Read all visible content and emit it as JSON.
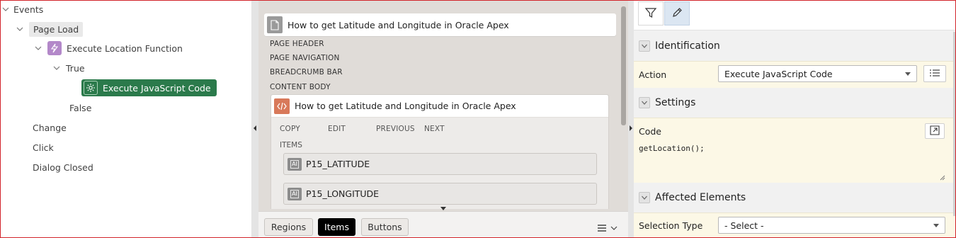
{
  "tree": {
    "events_label": "Events",
    "page_load_label": "Page Load",
    "execute_location_label": "Execute Location Function",
    "true_label": "True",
    "execute_js_label": "Execute JavaScript Code",
    "false_label": "False",
    "change_label": "Change",
    "click_label": "Click",
    "dialog_closed_label": "Dialog Closed"
  },
  "layout_panel": {
    "page_title": "How to get Latitude and Longitude in Oracle Apex",
    "positions": [
      "PAGE HEADER",
      "PAGE NAVIGATION",
      "BREADCRUMB BAR",
      "CONTENT BODY"
    ],
    "region_title": "How to get Latitude and Longitude in Oracle Apex",
    "region_positions": [
      "COPY",
      "EDIT",
      "PREVIOUS",
      "NEXT"
    ],
    "items_label": "ITEMS",
    "items": [
      "P15_LATITUDE",
      "P15_LONGITUDE"
    ],
    "item_icon_text": "AI",
    "tabs": [
      "Regions",
      "Items",
      "Buttons"
    ],
    "active_tab": "Items"
  },
  "property_editor": {
    "identification_title": "Identification",
    "action_label": "Action",
    "action_value": "Execute JavaScript Code",
    "settings_title": "Settings",
    "code_label": "Code",
    "code_value": "getLocation();",
    "affected_title": "Affected Elements",
    "selection_type_label": "Selection Type",
    "selection_type_value": "- Select -"
  },
  "colors": {
    "selected_node": "#2b7a4b",
    "dynamic_action_icon": "#b388c9",
    "region_icon": "#d8795a",
    "required_field_bg": "#fcf8e6",
    "frame": "#d2252b"
  },
  "icons": [
    "chevron-down-icon",
    "lightning-icon",
    "gear-icon",
    "page-icon",
    "code-icon",
    "item-icon",
    "filter-icon",
    "pencil-icon",
    "list-icon",
    "expand-icon",
    "menu-icon"
  ]
}
